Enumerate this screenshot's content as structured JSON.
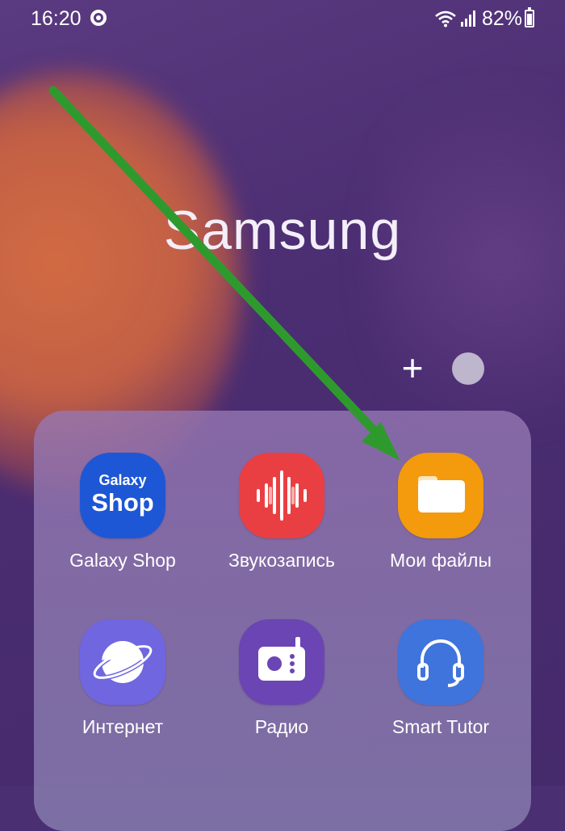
{
  "status_bar": {
    "time": "16:20",
    "battery": "82%"
  },
  "folder": {
    "title": "Samsung",
    "add_symbol": "+",
    "apps": [
      {
        "label": "Galaxy Shop",
        "icon": "galaxy-shop-icon",
        "icon_text_1": "Galaxy",
        "icon_text_2": "Shop",
        "color": "#1d57d6"
      },
      {
        "label": "Звукозапись",
        "icon": "voice-recorder-icon",
        "color": "#ea3f42"
      },
      {
        "label": "Мои файлы",
        "icon": "my-files-icon",
        "color": "#f39a0d"
      },
      {
        "label": "Интернет",
        "icon": "internet-icon",
        "color": "#6f66e0"
      },
      {
        "label": "Радио",
        "icon": "radio-icon",
        "color": "#6b45b3"
      },
      {
        "label": "Smart Tutor",
        "icon": "smart-tutor-icon",
        "color": "#3f74dd"
      }
    ]
  },
  "annotation": {
    "color": "#2e9a2e",
    "target": "Мои файлы"
  }
}
